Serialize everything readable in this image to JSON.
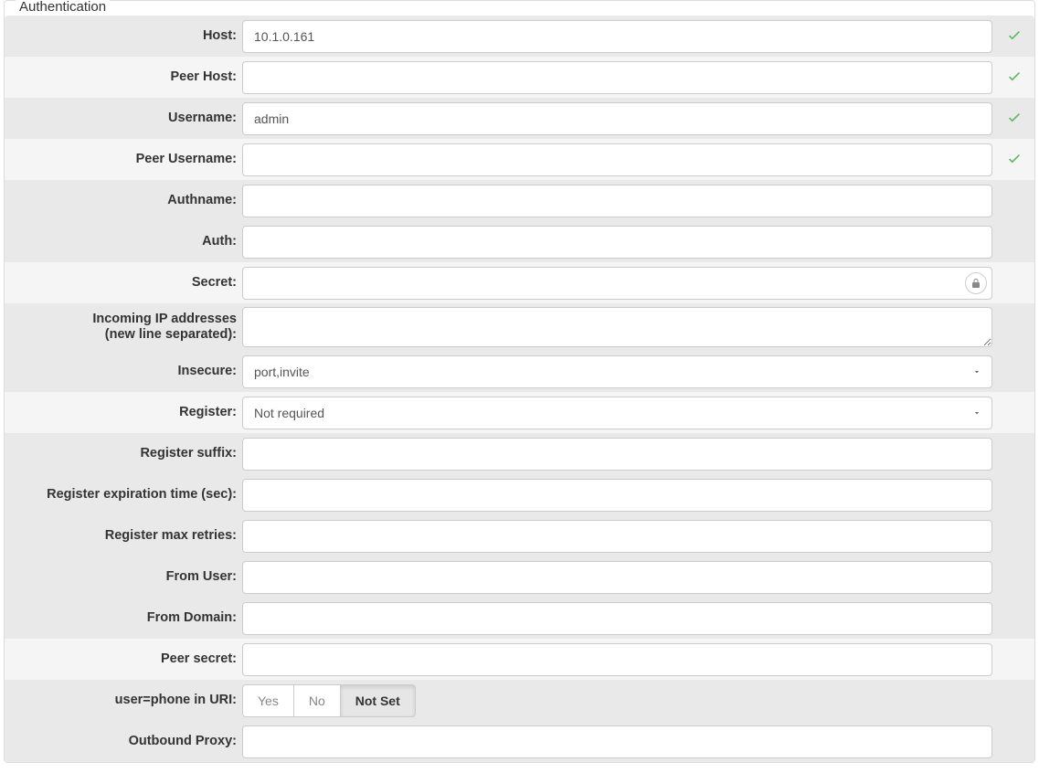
{
  "section_title": "Authentication",
  "fields": {
    "host": {
      "label": "Host:",
      "value": "10.1.0.161",
      "valid": true
    },
    "peer_host": {
      "label": "Peer Host:",
      "value": "",
      "valid": true
    },
    "username": {
      "label": "Username:",
      "value": "admin",
      "valid": true
    },
    "peer_username": {
      "label": "Peer Username:",
      "value": "",
      "valid": true
    },
    "authname": {
      "label": "Authname:",
      "value": ""
    },
    "auth": {
      "label": "Auth:",
      "value": ""
    },
    "secret": {
      "label": "Secret:",
      "value": ""
    },
    "incoming_ip": {
      "label_line1": "Incoming IP addresses",
      "label_line2": "(new line separated):",
      "value": ""
    },
    "insecure": {
      "label": "Insecure:",
      "value": "port,invite"
    },
    "register": {
      "label": "Register:",
      "value": "Not required"
    },
    "register_suffix": {
      "label": "Register suffix:",
      "value": ""
    },
    "register_exp": {
      "label": "Register expiration time (sec):",
      "value": ""
    },
    "register_retries": {
      "label": "Register max retries:",
      "value": ""
    },
    "from_user": {
      "label": "From User:",
      "value": ""
    },
    "from_domain": {
      "label": "From Domain:",
      "value": ""
    },
    "peer_secret": {
      "label": "Peer secret:",
      "value": ""
    },
    "user_phone": {
      "label": "user=phone in URI:",
      "options": {
        "yes": "Yes",
        "no": "No",
        "notset": "Not Set"
      },
      "selected": "notset"
    },
    "outbound_proxy": {
      "label": "Outbound Proxy:",
      "value": ""
    }
  }
}
